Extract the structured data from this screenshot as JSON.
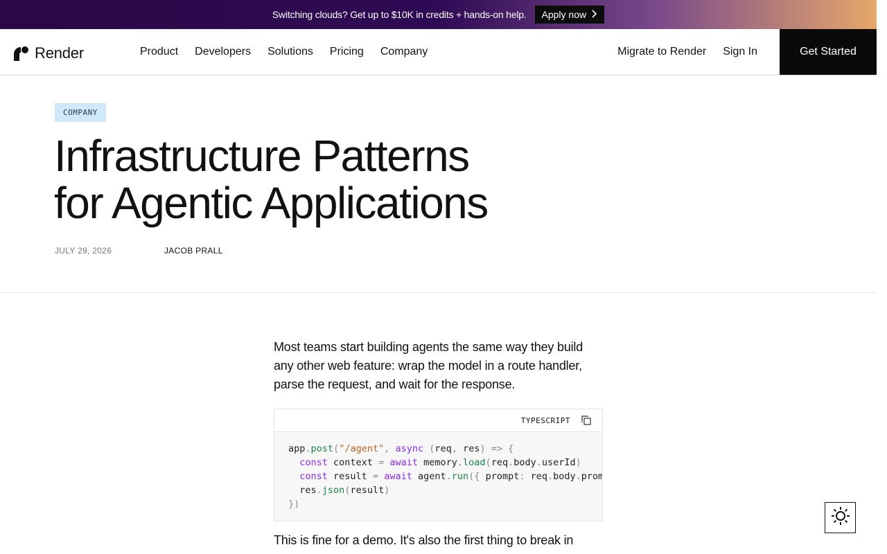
{
  "banner": {
    "text": "Switching clouds? Get up to $10K in credits + hands-on help.",
    "cta": "Apply now"
  },
  "nav": {
    "logo": "Render",
    "links": [
      "Product",
      "Developers",
      "Solutions",
      "Pricing",
      "Company"
    ],
    "migrate": "Migrate to Render",
    "sign_in": "Sign In",
    "get_started": "Get Started"
  },
  "hero": {
    "tag": "COMPANY",
    "title_line1": "Infrastructure Patterns",
    "title_line2": "for Agentic Applications",
    "date": "JULY 29, 2026",
    "author": "JACOB PRALL"
  },
  "article": {
    "intro": "Most teams start building agents the same way they build any other web feature: wrap the model in a route handler, parse the request, and wait for the response.",
    "code_lang": "TYPESCRIPT",
    "followup": "This is fine for a demo. It's also the first thing to break in"
  },
  "colors": {
    "banner_start": "#2a0845",
    "banner_end": "#e6a86b",
    "tag_bg": "#cfe9fb",
    "cta_bg": "#0a0a0a"
  }
}
